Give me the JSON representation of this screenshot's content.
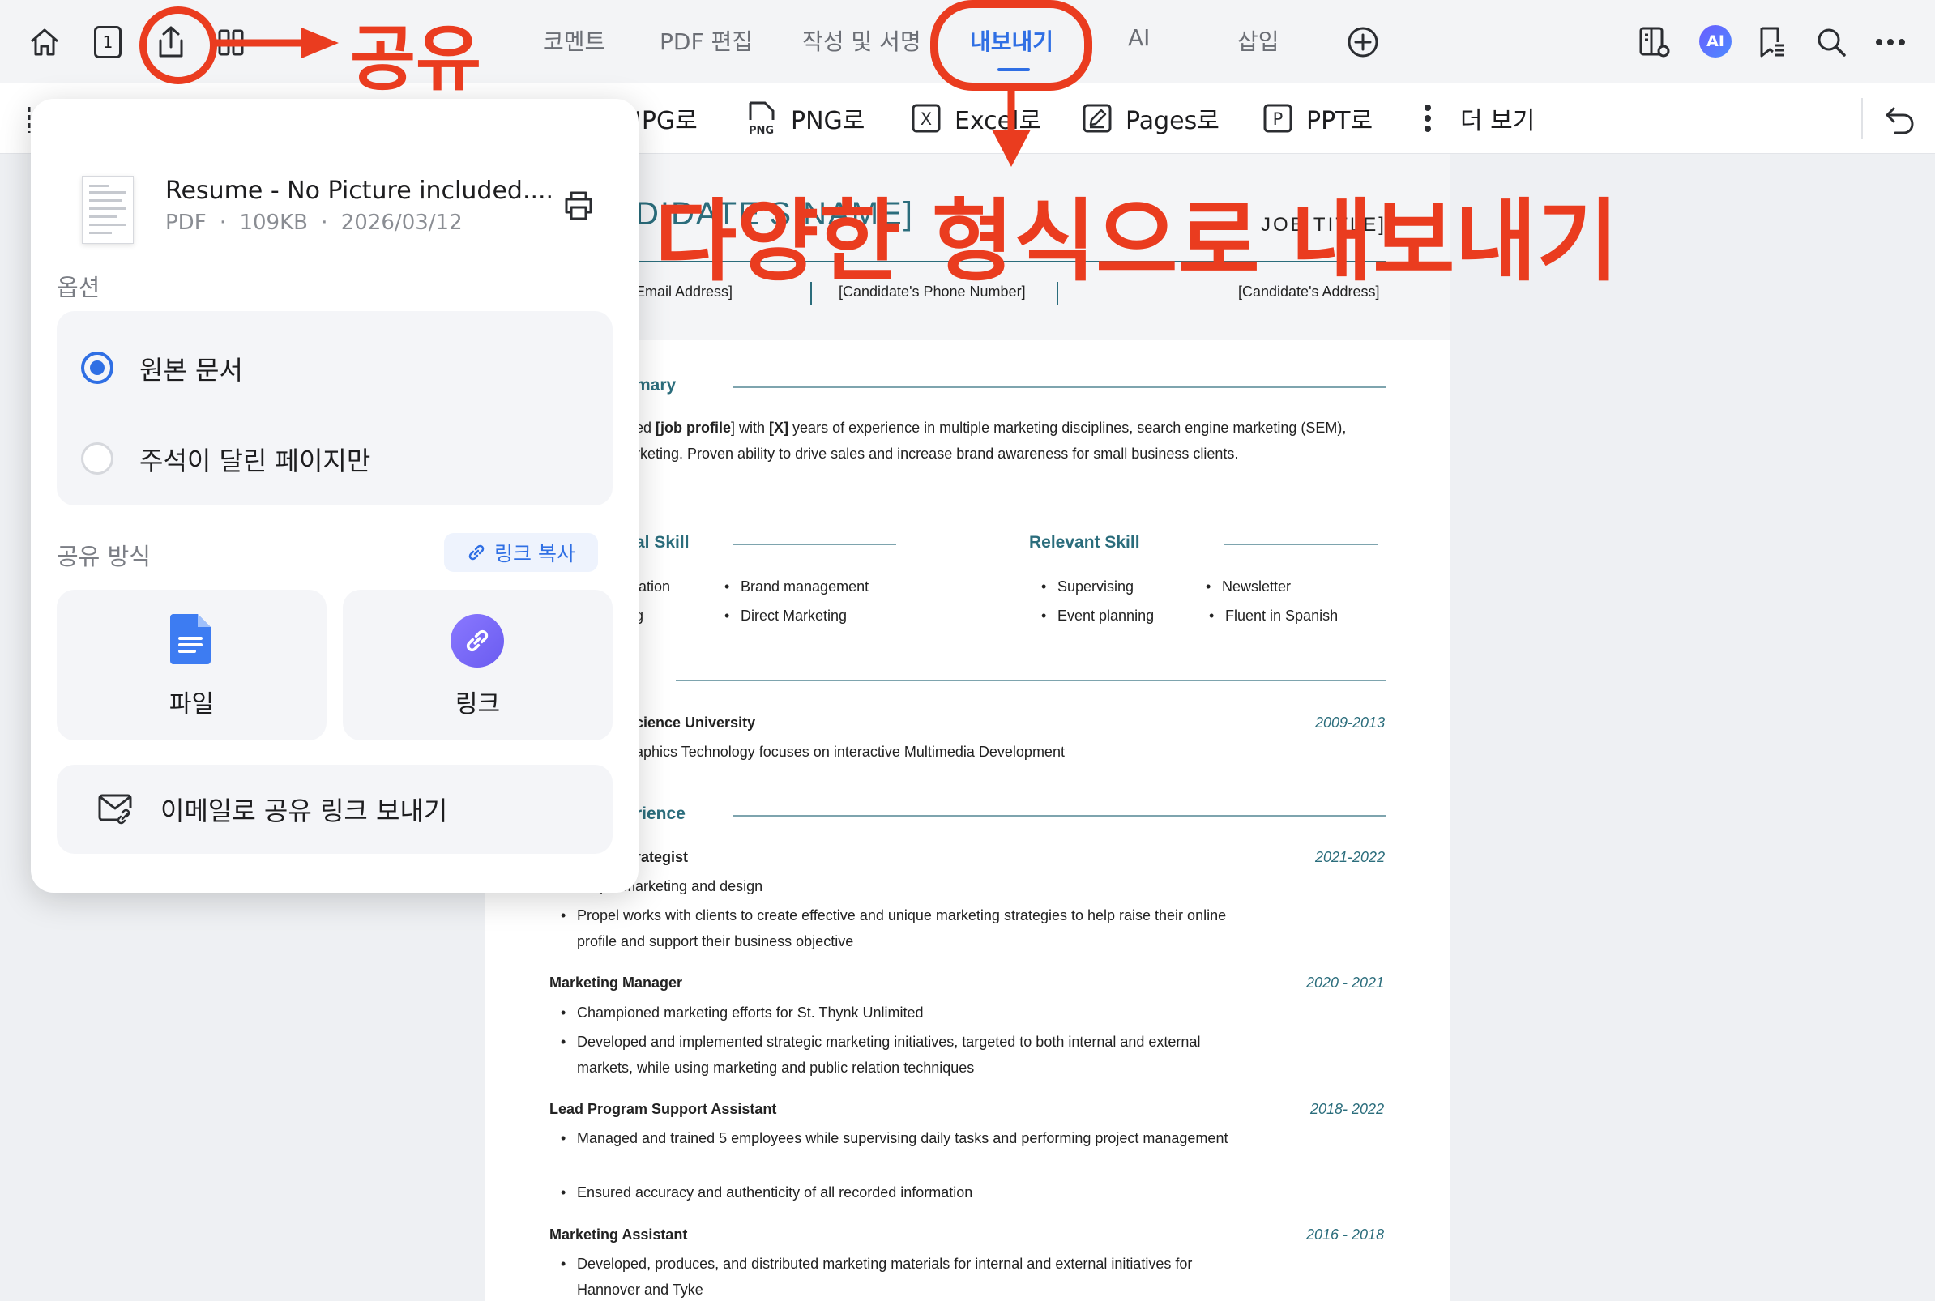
{
  "toolbar": {
    "page_number": "1",
    "tabs": [
      "코멘트",
      "PDF 편집",
      "작성 및 서명",
      "내보내기",
      "AI",
      "삽입"
    ],
    "ai_badge": "AI"
  },
  "export_bar": {
    "items": [
      "JPG로",
      "PNG로",
      "Excel로",
      "Pages로",
      "PPT로",
      "더 보기"
    ],
    "png_icon_text": "PNG",
    "excel_icon_text": "X",
    "ppt_icon_text": "P"
  },
  "share": {
    "file_name": "Resume - No Picture included....",
    "file_type": "PDF",
    "file_size": "109KB",
    "file_date": "2026/03/12",
    "options_label": "옵션",
    "option_original": "원본 문서",
    "option_annotated": "주석이 달린 페이지만",
    "share_method_label": "공유 방식",
    "copy_link_label": "링크 복사",
    "file_label": "파일",
    "link_label": "링크",
    "email_label": "이메일로 공유 링크 보내기"
  },
  "annotations": {
    "share": "공유",
    "export": "다양한 형식으로 내보내기"
  },
  "document": {
    "name_fragment": "DIDATE'S NAME]",
    "job_title": "JOB TITLE]",
    "email": "Email Address]",
    "phone": "[Candidate's Phone Number]",
    "address": "[Candidate's Address]",
    "summary_heading": "mary",
    "summary_line1_pre": "ed ",
    "summary_line1_bold1": "[job profile",
    "summary_line1_mid": "] with ",
    "summary_line1_bold2": "[X]",
    "summary_line1_post": " years of experience in multiple marketing disciplines, search engine marketing (SEM),",
    "summary_line2": "rketing. Proven ability to drive sales and increase brand awareness for small business clients.",
    "skill1_heading": "al Skill",
    "skill2_heading": "Relevant Skill",
    "skill1_col1": [
      "lation",
      "g"
    ],
    "skill1_col2": [
      "Brand management",
      "Direct Marketing"
    ],
    "skill2_col1": [
      "Supervising",
      "Event planning"
    ],
    "skill2_col2": [
      "Newsletter",
      "Fluent in Spanish"
    ],
    "edu_school": "cience University",
    "edu_date": "2009-2013",
    "edu_desc": "aphics Technology focuses on interactive Multimedia Development",
    "exp_heading": "rience",
    "jobs": [
      {
        "title": "rategist",
        "date": "2021-2022",
        "bullets": [
          "Propel marketing and design",
          "Propel works with clients to create effective and unique marketing strategies to help raise their online",
          "profile and support their business objective"
        ]
      },
      {
        "title": "Marketing Manager",
        "date": "2020 - 2021",
        "bullets": [
          "Championed marketing efforts for St. Thynk Unlimited",
          "Developed and implemented strategic marketing initiatives, targeted to both internal and external",
          "markets, while using marketing and public relation techniques"
        ]
      },
      {
        "title": "Lead Program Support Assistant",
        "date": "2018- 2022",
        "bullets": [
          "Managed and trained 5 employees while supervising daily tasks and performing project management",
          "Ensured accuracy and authenticity of all recorded information"
        ]
      },
      {
        "title": "Marketing Assistant",
        "date": "2016 - 2018",
        "bullets": [
          "Developed, produces, and distributed marketing materials for internal and external initiatives for",
          "Hannover and Tyke"
        ]
      }
    ]
  },
  "colors": {
    "accent": "#2f6fe4",
    "annotation_red": "#ea3c1f",
    "resume_teal": "#2b6d7c"
  }
}
